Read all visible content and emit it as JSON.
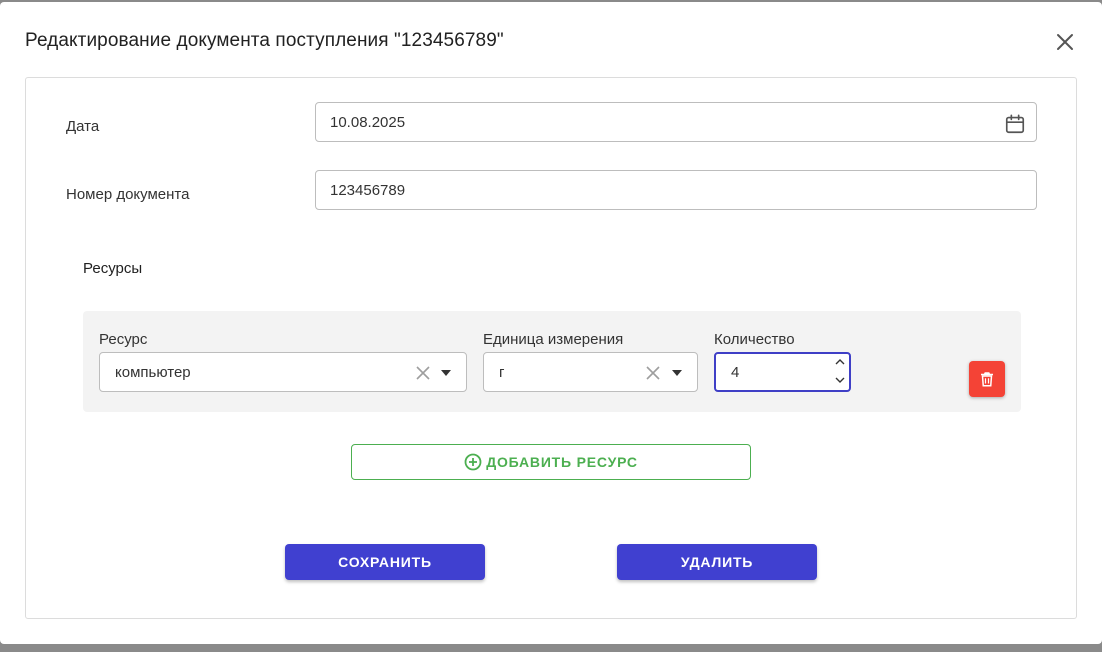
{
  "dialog": {
    "title": "Редактирование документа поступления \"123456789\"",
    "close_icon": "close-icon"
  },
  "form": {
    "date_label": "Дата",
    "date_value": "10.08.2025",
    "date_icon": "calendar-icon",
    "doc_number_label": "Номер документа",
    "doc_number_value": "123456789"
  },
  "resources": {
    "section_title": "Ресурсы",
    "rows": [
      {
        "resource_label": "Ресурс",
        "resource_value": "компьютер",
        "unit_label": "Единица измерения",
        "unit_value": "г",
        "quantity_label": "Количество",
        "quantity_value": "4",
        "delete_icon": "trash-icon"
      }
    ],
    "add_button_label": "ДОБАВИТЬ РЕСУРС",
    "add_icon": "plus-circle-icon"
  },
  "actions": {
    "save_label": "СОХРАНИТЬ",
    "delete_label": "УДАЛИТЬ"
  },
  "colors": {
    "primary": "#4040d0",
    "danger": "#f44336",
    "success": "#4caf50",
    "focus_border": "#3f3fc6"
  }
}
